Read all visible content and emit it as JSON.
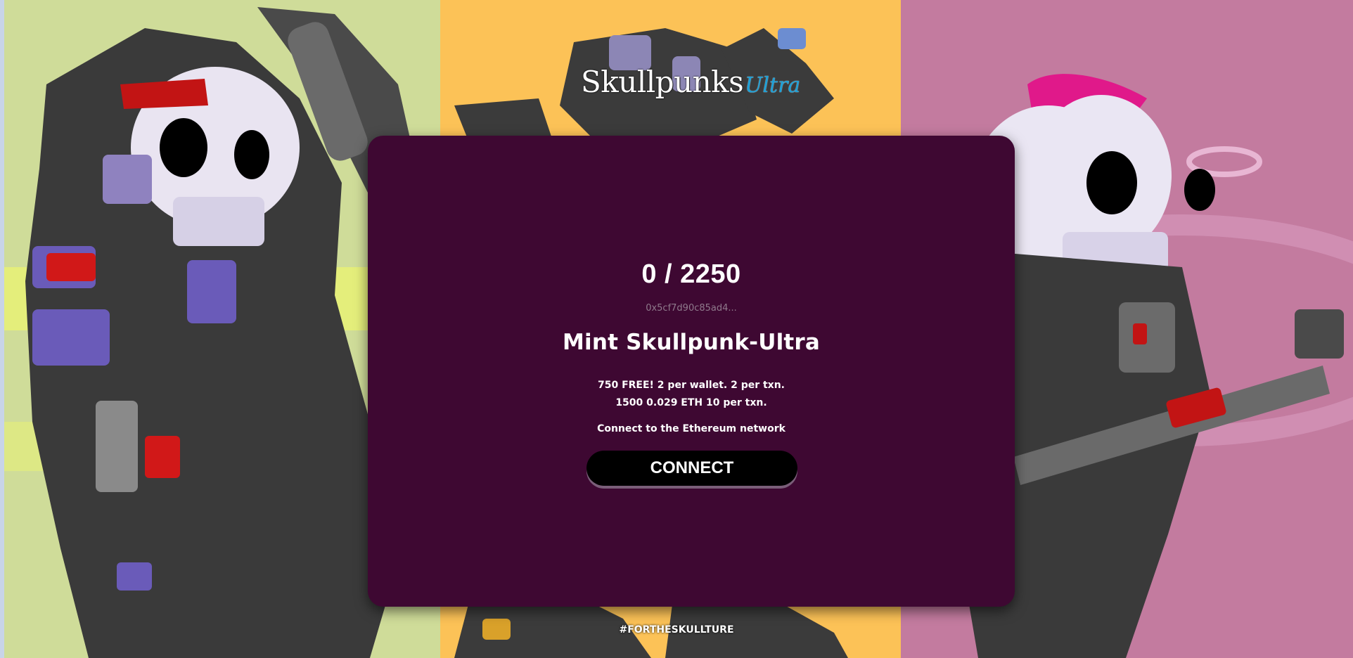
{
  "brand": {
    "logo_main": "Skullpunks",
    "logo_script": "Ultra"
  },
  "mint": {
    "count": "0 / 2250",
    "contract_address": "0x5cf7d90c85ad4...",
    "title": "Mint Skullpunk-Ultra",
    "info_line_1": "750 FREE! 2 per wallet. 2 per txn.",
    "info_line_2": "1500 0.029 ETH 10 per txn.",
    "connect_note": "Connect to the Ethereum network",
    "connect_label": "CONNECT"
  },
  "footer": {
    "hashtag": "#FORTHESKULLTURE"
  },
  "colors": {
    "card_bg": "#3e0832",
    "panel_left": "#cfdc99",
    "panel_middle": "#fcc257",
    "panel_right": "#c37b9f",
    "logo_accent": "#1aa0d8",
    "button_bg": "#000000"
  }
}
